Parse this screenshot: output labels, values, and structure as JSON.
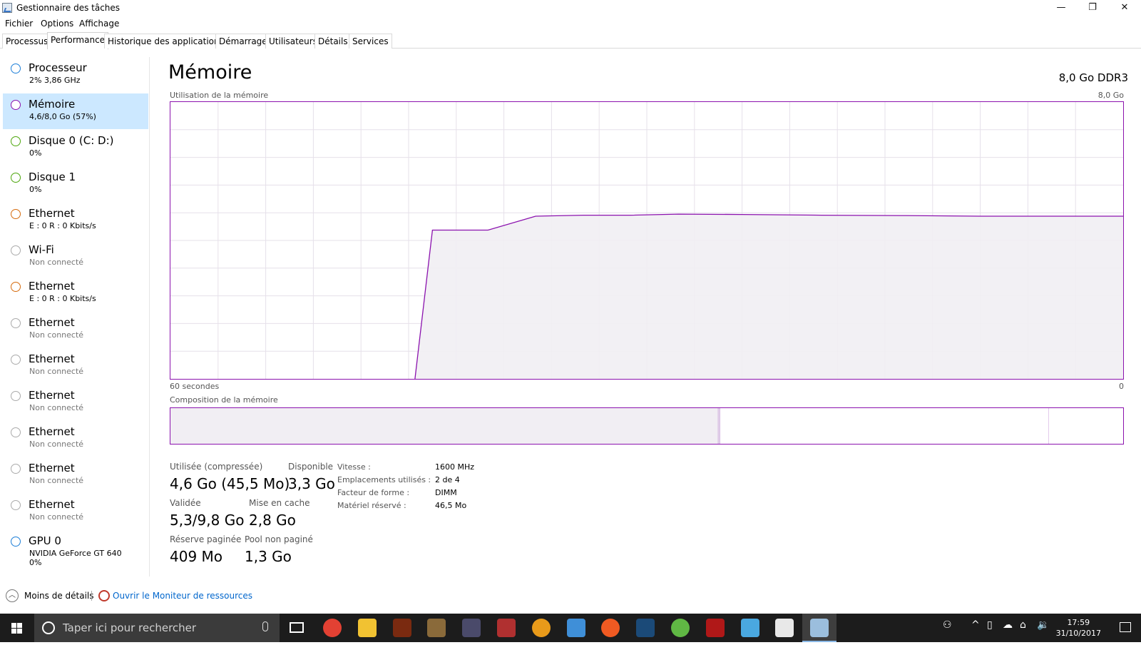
{
  "window": {
    "title": "Gestionnaire des tâches",
    "minimize_glyph": "—",
    "restore_glyph": "❐",
    "close_glyph": "✕"
  },
  "menu": [
    "Fichier",
    "Options",
    "Affichage"
  ],
  "tabs": [
    "Processus",
    "Performance",
    "Historique des applications",
    "Démarrage",
    "Utilisateurs",
    "Détails",
    "Services"
  ],
  "sidebar": [
    {
      "name": "Processeur",
      "line1": "2% 3,86 GHz",
      "line2": "",
      "color": "#1d7fd8"
    },
    {
      "name": "Mémoire",
      "line1": "4,6/8,0 Go (57%)",
      "line2": "",
      "color": "#8b12ae"
    },
    {
      "name": "Disque 0 (C: D:)",
      "line1": "0%",
      "line2": "",
      "color": "#4da60c"
    },
    {
      "name": "Disque 1",
      "line1": "0%",
      "line2": "",
      "color": "#4da60c"
    },
    {
      "name": "Ethernet",
      "line1": "E : 0 R : 0 Kbits/s",
      "line2": "",
      "color": "#d56a0c"
    },
    {
      "name": "Wi-Fi",
      "line1": "Non connecté",
      "line2": "",
      "color": "#aaaaaa"
    },
    {
      "name": "Ethernet",
      "line1": "E : 0 R : 0 Kbits/s",
      "line2": "",
      "color": "#d56a0c"
    },
    {
      "name": "Ethernet",
      "line1": "Non connecté",
      "line2": "",
      "color": "#aaaaaa"
    },
    {
      "name": "Ethernet",
      "line1": "Non connecté",
      "line2": "",
      "color": "#aaaaaa"
    },
    {
      "name": "Ethernet",
      "line1": "Non connecté",
      "line2": "",
      "color": "#aaaaaa"
    },
    {
      "name": "Ethernet",
      "line1": "Non connecté",
      "line2": "",
      "color": "#aaaaaa"
    },
    {
      "name": "Ethernet",
      "line1": "Non connecté",
      "line2": "",
      "color": "#aaaaaa"
    },
    {
      "name": "Ethernet",
      "line1": "Non connecté",
      "line2": "",
      "color": "#aaaaaa"
    },
    {
      "name": "GPU 0",
      "line1": "NVIDIA GeForce GT 640",
      "line2": "0%",
      "color": "#1d7fd8"
    }
  ],
  "main": {
    "title": "Mémoire",
    "spec": "8,0 Go DDR3",
    "graph_label": "Utilisation de la mémoire",
    "graph_max": "8,0 Go",
    "graph_left": "60 secondes",
    "graph_right": "0",
    "composition_label": "Composition de la mémoire",
    "accent": "#8b12ae"
  },
  "chart_data": {
    "type": "area",
    "title": "Utilisation de la mémoire",
    "xlabel": "60 secondes",
    "ylabel": "",
    "xlim": [
      60,
      0
    ],
    "ylim": [
      0,
      8.0
    ],
    "unit": "Go",
    "x": [
      60,
      51.0,
      50.5,
      49.8,
      48.2,
      47.0,
      46.8,
      45.9,
      45.0,
      44.6,
      43.5,
      40.0,
      37.0,
      34.0,
      31.0,
      28.0,
      24.0,
      19.0,
      14.0,
      9.0,
      4.0,
      0
    ],
    "values": [
      0,
      0,
      0,
      0,
      0,
      0,
      0,
      0,
      0,
      0,
      0,
      0,
      0,
      0,
      0,
      0,
      0,
      0,
      0,
      0,
      0,
      0
    ],
    "series": [
      {
        "values": [
          null,
          null,
          null,
          null,
          null,
          null,
          null,
          null,
          null,
          0,
          4.3,
          4.3,
          4.7,
          4.73,
          4.73,
          4.76,
          4.75,
          4.73,
          4.72,
          4.7,
          4.7,
          4.7
        ]
      }
    ],
    "composition": [
      {
        "part": "used",
        "fraction": 0.575
      },
      {
        "part": "modified",
        "fraction": 0.002
      },
      {
        "part": "standby",
        "fraction": 0.345
      },
      {
        "part": "free",
        "fraction": 0.078
      }
    ]
  },
  "stats": {
    "used_label": "Utilisée (compressée)",
    "used_value": "4,6 Go (45,5 Mo)",
    "available_label": "Disponible",
    "available_value": "3,3 Go",
    "committed_label": "Validée",
    "committed_value": "5,3/9,8 Go",
    "cached_label": "Mise en cache",
    "cached_value": "2,8 Go",
    "paged_label": "Réserve paginée",
    "paged_value": "409 Mo",
    "nonpaged_label": "Pool non paginé",
    "nonpaged_value": "1,3 Go"
  },
  "info": [
    {
      "label": "Vitesse :",
      "value": "1600 MHz"
    },
    {
      "label": "Emplacements utilisés :",
      "value": "2 de 4"
    },
    {
      "label": "Facteur de forme :",
      "value": "DIMM"
    },
    {
      "label": "Matériel réservé :",
      "value": "46,5 Mo"
    }
  ],
  "footer": {
    "less_details": "Moins de détails",
    "resource_monitor": "Ouvrir le Moniteur de ressources"
  },
  "taskbar": {
    "search_placeholder": "Taper ici pour rechercher",
    "time": "17:59",
    "date": "31/10/2017",
    "apps": [
      {
        "name": "chrome-icon",
        "color": "#e34133"
      },
      {
        "name": "file-explorer-icon",
        "color": "#f1c232"
      },
      {
        "name": "diablo-icon",
        "color": "#7a2a10"
      },
      {
        "name": "hearthstone-icon",
        "color": "#8a6a3a"
      },
      {
        "name": "game-app-icon",
        "color": "#4a4a6a"
      },
      {
        "name": "calendar-app-icon",
        "color": "#b03030"
      },
      {
        "name": "half-life-icon",
        "color": "#e89a1a"
      },
      {
        "name": "blue-app-icon",
        "color": "#3f8fd8"
      },
      {
        "name": "origin-icon",
        "color": "#f05a22"
      },
      {
        "name": "steam-icon",
        "color": "#1b4a78"
      },
      {
        "name": "utorrent-icon",
        "color": "#60b844"
      },
      {
        "name": "asus-icon",
        "color": "#b01818"
      },
      {
        "name": "display-app-icon",
        "color": "#4aa8e0"
      },
      {
        "name": "mail-icon",
        "color": "#e8e8e8"
      },
      {
        "name": "task-manager-icon",
        "color": "#9bbedd"
      }
    ]
  }
}
